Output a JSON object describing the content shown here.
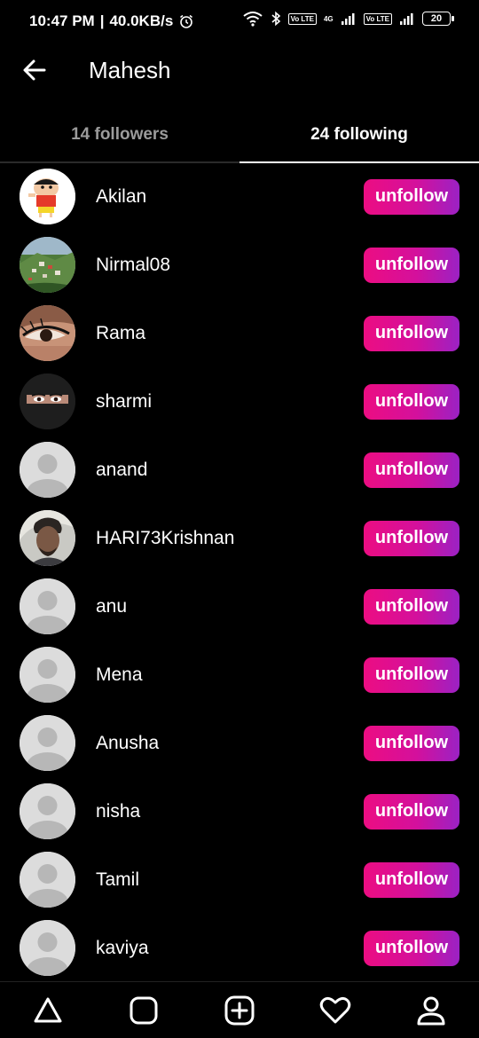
{
  "status": {
    "time": "10:47 PM",
    "separator": "|",
    "speed": "40.0KB/s",
    "volte1": "Vo LTE",
    "net1": "4G",
    "volte2": "Vo LTE",
    "battery": "20"
  },
  "header": {
    "title": "Mahesh"
  },
  "tabs": {
    "followers": "14 followers",
    "following": "24 following"
  },
  "users": [
    {
      "name": "Akilan",
      "action": "unfollow"
    },
    {
      "name": "Nirmal08",
      "action": "unfollow"
    },
    {
      "name": "Rama",
      "action": "unfollow"
    },
    {
      "name": "sharmi",
      "action": "unfollow"
    },
    {
      "name": "anand",
      "action": "unfollow"
    },
    {
      "name": "HARI73Krishnan",
      "action": "unfollow"
    },
    {
      "name": "anu",
      "action": "unfollow"
    },
    {
      "name": "Mena",
      "action": "unfollow"
    },
    {
      "name": "Anusha",
      "action": "unfollow"
    },
    {
      "name": "nisha",
      "action": "unfollow"
    },
    {
      "name": "Tamil",
      "action": "unfollow"
    },
    {
      "name": "kaviya",
      "action": "unfollow"
    }
  ],
  "nav": {
    "items": [
      "home-icon",
      "reels-icon",
      "add-post-icon",
      "heart-icon",
      "profile-icon"
    ]
  },
  "colors": {
    "background": "#000000",
    "button_gradient_start": "#ec0d82",
    "button_gradient_end": "#9b22c4",
    "inactive_tab": "#9b9b9b"
  }
}
